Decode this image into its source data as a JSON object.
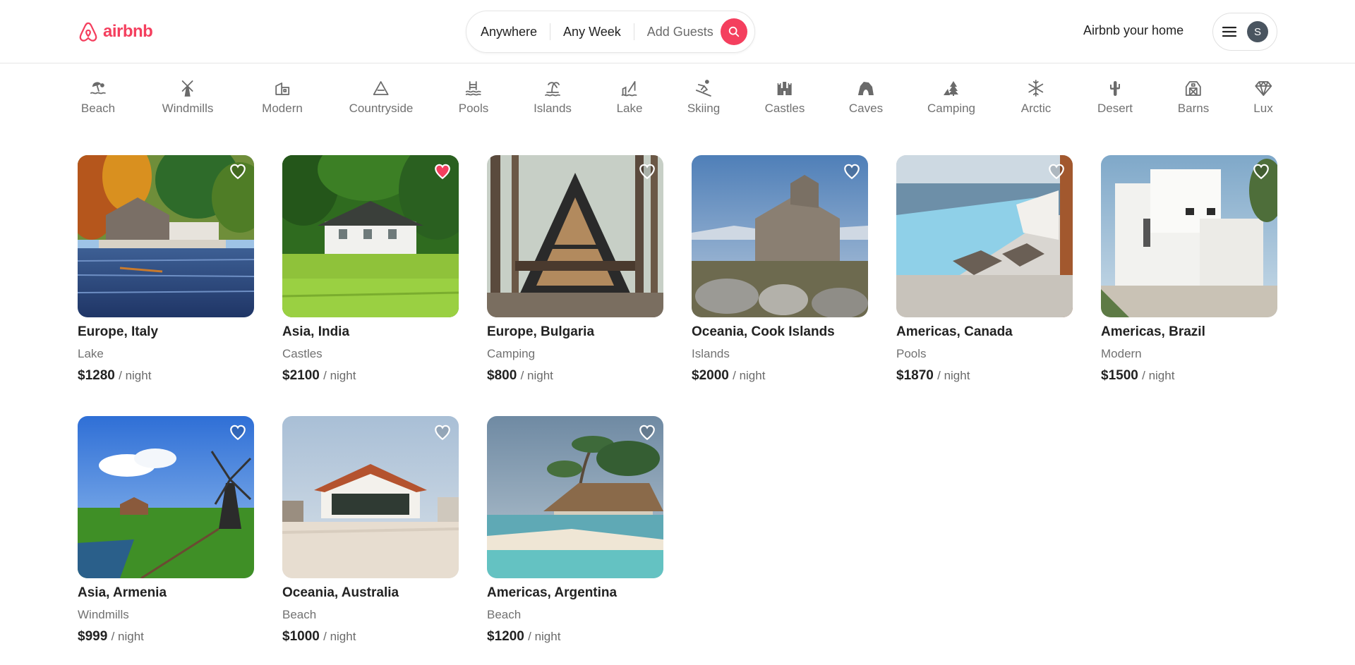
{
  "header": {
    "logo_text": "airbnb",
    "search": {
      "location": "Anywhere",
      "dates": "Any Week",
      "guests": "Add Guests"
    },
    "host_link": "Airbnb your home",
    "avatar_initial": "S"
  },
  "categories": [
    {
      "label": "Beach",
      "icon": "beach-icon"
    },
    {
      "label": "Windmills",
      "icon": "windmill-icon"
    },
    {
      "label": "Modern",
      "icon": "modern-house-icon"
    },
    {
      "label": "Countryside",
      "icon": "mountain-icon"
    },
    {
      "label": "Pools",
      "icon": "pool-icon"
    },
    {
      "label": "Islands",
      "icon": "island-icon"
    },
    {
      "label": "Lake",
      "icon": "lake-icon"
    },
    {
      "label": "Skiing",
      "icon": "skiing-icon"
    },
    {
      "label": "Castles",
      "icon": "castle-icon"
    },
    {
      "label": "Caves",
      "icon": "cave-icon"
    },
    {
      "label": "Camping",
      "icon": "camping-icon"
    },
    {
      "label": "Arctic",
      "icon": "snowflake-icon"
    },
    {
      "label": "Desert",
      "icon": "cactus-icon"
    },
    {
      "label": "Barns",
      "icon": "barn-icon"
    },
    {
      "label": "Lux",
      "icon": "diamond-icon"
    }
  ],
  "listings": [
    {
      "location": "Europe, Italy",
      "category": "Lake",
      "price": "$1280",
      "unit": "/ night",
      "favorited": false
    },
    {
      "location": "Asia, India",
      "category": "Castles",
      "price": "$2100",
      "unit": "/ night",
      "favorited": true
    },
    {
      "location": "Europe, Bulgaria",
      "category": "Camping",
      "price": "$800",
      "unit": "/ night",
      "favorited": false
    },
    {
      "location": "Oceania, Cook Islands",
      "category": "Islands",
      "price": "$2000",
      "unit": "/ night",
      "favorited": false
    },
    {
      "location": "Americas, Canada",
      "category": "Pools",
      "price": "$1870",
      "unit": "/ night",
      "favorited": false
    },
    {
      "location": "Americas, Brazil",
      "category": "Modern",
      "price": "$1500",
      "unit": "/ night",
      "favorited": false
    },
    {
      "location": "Asia, Armenia",
      "category": "Windmills",
      "price": "$999",
      "unit": "/ night",
      "favorited": false
    },
    {
      "location": "Oceania, Australia",
      "category": "Beach",
      "price": "$1000",
      "unit": "/ night",
      "favorited": false
    },
    {
      "location": "Americas, Argentina",
      "category": "Beach",
      "price": "$1200",
      "unit": "/ night",
      "favorited": false
    }
  ],
  "colors": {
    "brand": "#f43f5e",
    "muted_text": "#717171",
    "heart_active": "#f43f5e"
  }
}
